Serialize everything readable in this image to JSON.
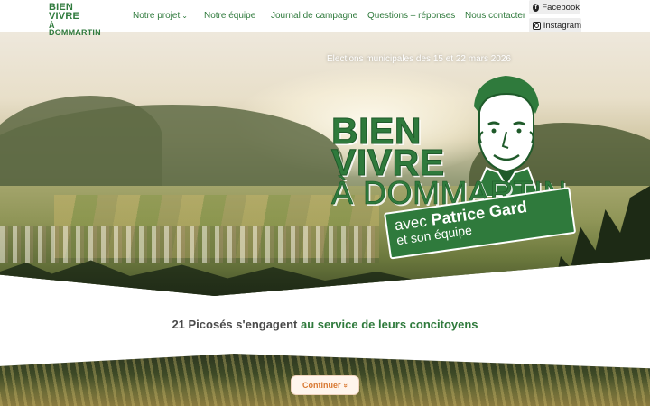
{
  "header": {
    "logo": {
      "line1": "BIEN",
      "line2": "VIVRE",
      "line3": "À DOMMARTIN"
    },
    "nav": [
      {
        "label": "Notre projet",
        "has_dropdown": true
      },
      {
        "label": "Notre équipe"
      },
      {
        "label": "Journal de campagne"
      },
      {
        "label": "Questions – réponses"
      },
      {
        "label": "Nous contacter"
      }
    ],
    "social": [
      {
        "label": "Facebook",
        "icon": "facebook-icon"
      },
      {
        "label": "Instagram",
        "icon": "instagram-icon"
      }
    ]
  },
  "hero": {
    "election_text": "Elections municipales des 15 et 22 mars 2026",
    "title_line1": "BIEN",
    "title_line2": "VIVRE",
    "title_line3": "À DOMMARTIN",
    "badge_line1_prefix": "avec",
    "badge_line1_name": "Patrice Gard",
    "badge_line2": "et son équipe"
  },
  "tagline": {
    "text": "21 Picosés s'engagent",
    "accent": "au service de leurs concitoyens"
  },
  "continue_button": {
    "label": "Continuer",
    "icon": "double-chevron-down-icon"
  },
  "colors": {
    "brand_green": "#2f7a3c",
    "accent_orange": "#d8772f",
    "text_gray": "#4a4a4a"
  }
}
